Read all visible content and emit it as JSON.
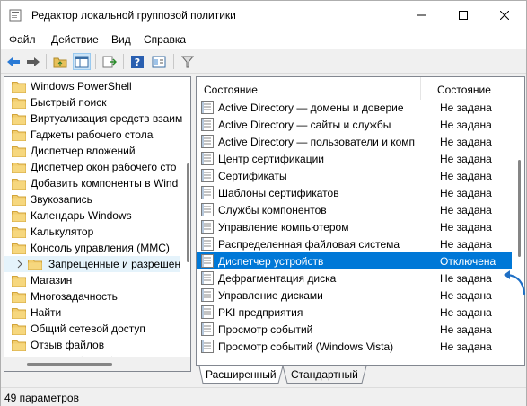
{
  "window": {
    "title": "Редактор локальной групповой политики"
  },
  "menu": [
    "Файл",
    "Действие",
    "Вид",
    "Справка"
  ],
  "tree": {
    "items": [
      "Windows PowerShell",
      "Быстрый поиск",
      "Виртуализация средств взаим",
      "Гаджеты рабочего стола",
      "Диспетчер вложений",
      "Диспетчер окон рабочего сто",
      "Добавить компоненты в Wind",
      "Звукозапись",
      "Календарь Windows",
      "Калькулятор",
      "Консоль управления (MMC)",
      "Запрещенные и разрешен",
      "Магазин",
      "Многозадачность",
      "Найти",
      "Общий сетевой доступ",
      "Отзыв файлов",
      "Отчеты об ошибках Windows"
    ],
    "selected_index": 11
  },
  "list": {
    "columns": {
      "name": "Состояние",
      "state": "Состояние"
    },
    "rows": [
      {
        "name": "Active Directory — домены и доверие",
        "state": "Не задана"
      },
      {
        "name": "Active Directory — сайты и службы",
        "state": "Не задана"
      },
      {
        "name": "Active Directory — пользователи и комп",
        "state": "Не задана"
      },
      {
        "name": "Центр сертификации",
        "state": "Не задана"
      },
      {
        "name": "Сертификаты",
        "state": "Не задана"
      },
      {
        "name": "Шаблоны сертификатов",
        "state": "Не задана"
      },
      {
        "name": "Службы компонентов",
        "state": "Не задана"
      },
      {
        "name": "Управление компьютером",
        "state": "Не задана"
      },
      {
        "name": "Распределенная файловая система",
        "state": "Не задана"
      },
      {
        "name": "Диспетчер устройств",
        "state": "Отключена"
      },
      {
        "name": "Дефрагментация диска",
        "state": "Не задана"
      },
      {
        "name": "Управление дисками",
        "state": "Не задана"
      },
      {
        "name": "PKI предприятия",
        "state": "Не задана"
      },
      {
        "name": "Просмотр событий",
        "state": "Не задана"
      },
      {
        "name": "Просмотр событий (Windows Vista)",
        "state": "Не задана"
      }
    ],
    "selected_index": 9
  },
  "tabs": [
    "Расширенный",
    "Стандартный"
  ],
  "status": "49 параметров",
  "colors": {
    "selection": "#0078d7",
    "annotation_arrow": "#1e6fc5"
  }
}
